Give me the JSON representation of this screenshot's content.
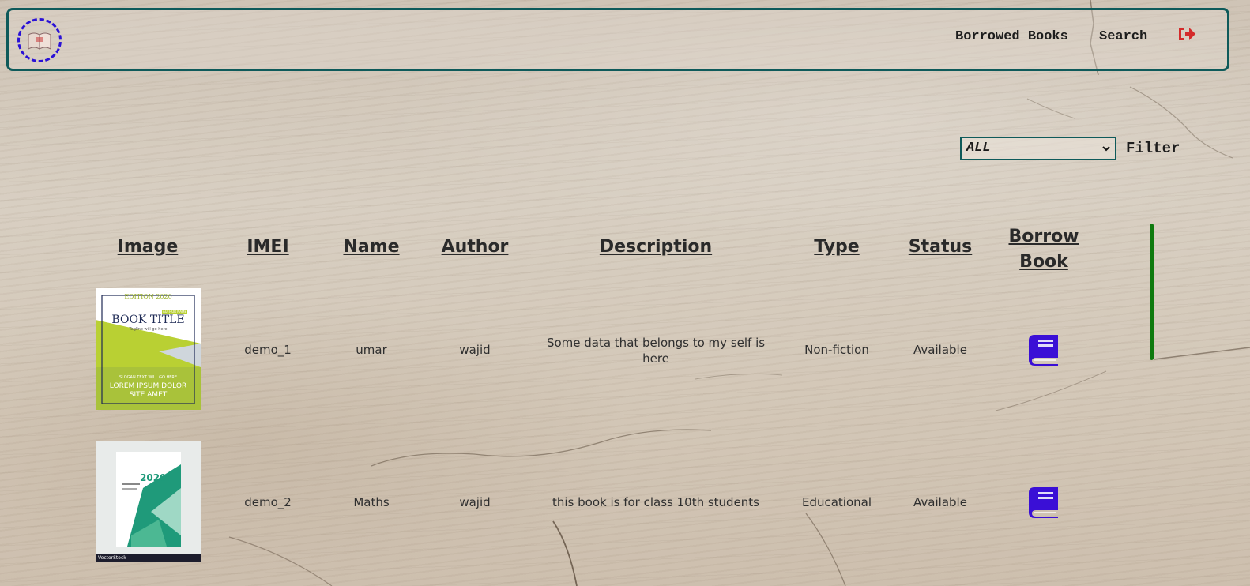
{
  "nav": {
    "logo_icon": "library-logo-icon",
    "borrowed_books_label": "Borrowed Books",
    "search_label": "Search",
    "logout_icon": "logout-icon"
  },
  "filter": {
    "selected": "ALL",
    "label": "Filter"
  },
  "table": {
    "headers": {
      "image": "Image",
      "imei": "IMEI",
      "name": "Name",
      "author": "Author",
      "description": "Description",
      "type": "Type",
      "status": "Status",
      "borrow_line1": "Borrow",
      "borrow_line2": "Book"
    },
    "rows": [
      {
        "cover": {
          "edition": "EDITION 2020",
          "badge": "AUTHOR NAME",
          "title": "BOOK TITLE",
          "tagline": "Tagline will go here",
          "slogan": "SLOGAN TEXT WILL GO HERE",
          "lorem1": "LOREM IPSUM DOLOR",
          "lorem2": "SITE AMET"
        },
        "imei": "demo_1",
        "name": "umar",
        "author": "wajid",
        "description_line1": "Some data that belongs to my self is",
        "description_line2": "here",
        "type": "Non-fiction",
        "status": "Available",
        "borrow_icon": "book-icon"
      },
      {
        "cover": {
          "year": "2020",
          "brand": "VectorStock"
        },
        "imei": "demo_2",
        "name": "Maths",
        "author": "wajid",
        "description_line1": "this book is for class 10th students",
        "type": "Educational",
        "status": "Available",
        "borrow_icon": "book-icon"
      }
    ]
  },
  "colors": {
    "nav_border": "#0e5a5a",
    "logo_dash": "#2a11d6",
    "logout": "#d42a2a",
    "borrow_icon": "#3a0fd6",
    "scrollbar": "#0e7a0e"
  }
}
